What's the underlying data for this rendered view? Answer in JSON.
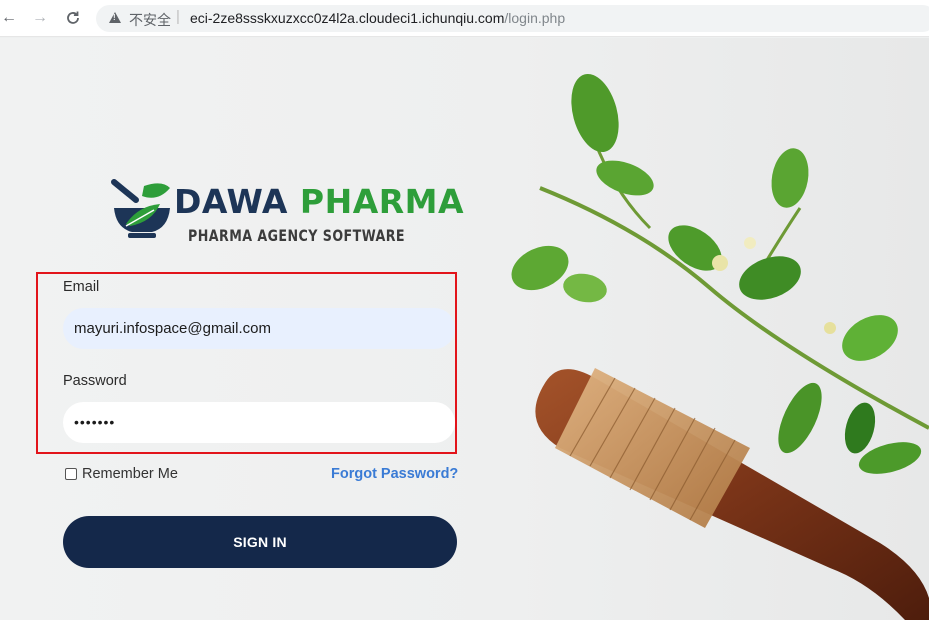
{
  "browser": {
    "back_icon": "←",
    "forward_icon": "→",
    "reload_icon": "C",
    "security_label": "不安全",
    "separator": "|",
    "url_host": "eci-2ze8ssskxuzxcc0z4l2a.cloudeci1.ichunqiu.com",
    "url_path": "/login.php"
  },
  "logo": {
    "title_part1": "DAWA",
    "title_part2": "PHARMA",
    "subtitle": "PHARMA AGENCY SOFTWARE"
  },
  "form": {
    "email_label": "Email",
    "email_value": "mayuri.infospace@gmail.com",
    "password_label": "Password",
    "password_value": "•••••••",
    "remember_label": "Remember Me",
    "forgot_label": "Forgot Password?",
    "signin_label": "SIGN IN"
  },
  "colors": {
    "brand_navy": "#14284a",
    "brand_green": "#2e9e3a",
    "link_blue": "#3a7bd5",
    "highlight_red": "#e2141b",
    "autofill_bg": "#e8f0fe"
  },
  "icons": {
    "warning": "warning-triangle-icon",
    "logo": "mortar-pestle-leaf-icon",
    "decor": "herb-and-pestle-illustration"
  }
}
